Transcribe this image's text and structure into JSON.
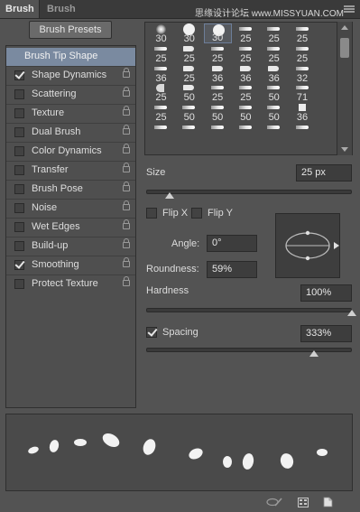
{
  "tabs": [
    {
      "label": "Brush",
      "active": true
    },
    {
      "label": "Brush Presets",
      "active": false
    }
  ],
  "watermark": "思缘设计论坛 www.MISSYUAN.COM",
  "presets_button": "Brush Presets",
  "options": [
    {
      "label": "Brush Tip Shape",
      "selected": true,
      "has_check": false,
      "checked": false,
      "locked": false
    },
    {
      "label": "Shape Dynamics",
      "selected": false,
      "has_check": true,
      "checked": true,
      "locked": true
    },
    {
      "label": "Scattering",
      "selected": false,
      "has_check": true,
      "checked": false,
      "locked": true
    },
    {
      "label": "Texture",
      "selected": false,
      "has_check": true,
      "checked": false,
      "locked": true
    },
    {
      "label": "Dual Brush",
      "selected": false,
      "has_check": true,
      "checked": false,
      "locked": true
    },
    {
      "label": "Color Dynamics",
      "selected": false,
      "has_check": true,
      "checked": false,
      "locked": true
    },
    {
      "label": "Transfer",
      "selected": false,
      "has_check": true,
      "checked": false,
      "locked": true
    },
    {
      "label": "Brush Pose",
      "selected": false,
      "has_check": true,
      "checked": false,
      "locked": true
    },
    {
      "label": "Noise",
      "selected": false,
      "has_check": true,
      "checked": false,
      "locked": true
    },
    {
      "label": "Wet Edges",
      "selected": false,
      "has_check": true,
      "checked": false,
      "locked": true
    },
    {
      "label": "Build-up",
      "selected": false,
      "has_check": true,
      "checked": false,
      "locked": true
    },
    {
      "label": "Smoothing",
      "selected": false,
      "has_check": true,
      "checked": true,
      "locked": true
    },
    {
      "label": "Protect Texture",
      "selected": false,
      "has_check": true,
      "checked": false,
      "locked": true
    }
  ],
  "brush_sizes": [
    [
      "30",
      "30",
      "30",
      "25",
      "25",
      "25"
    ],
    [
      "25",
      "25",
      "25",
      "25",
      "25",
      "25"
    ],
    [
      "36",
      "25",
      "36",
      "36",
      "36",
      "32"
    ],
    [
      "25",
      "50",
      "25",
      "25",
      "50",
      "71"
    ],
    [
      "25",
      "50",
      "50",
      "50",
      "50",
      "36"
    ],
    [
      "",
      "",
      "",
      "",
      "",
      ""
    ]
  ],
  "selected_cell": {
    "row": 0,
    "col": 2
  },
  "size": {
    "label": "Size",
    "value": "25 px",
    "slider": 0.18
  },
  "flip_x": {
    "label": "Flip X",
    "checked": false
  },
  "flip_y": {
    "label": "Flip Y",
    "checked": false
  },
  "angle": {
    "label": "Angle:",
    "value": "0°"
  },
  "roundness": {
    "label": "Roundness:",
    "value": "59%"
  },
  "hardness": {
    "label": "Hardness",
    "value": "100%",
    "slider": 1.0
  },
  "spacing": {
    "label": "Spacing",
    "value": "333%",
    "checked": true,
    "slider": 0.82
  },
  "colors": {
    "panel": "#535353",
    "selected_row": "#7a8aa0",
    "field": "#3d3d3d"
  }
}
